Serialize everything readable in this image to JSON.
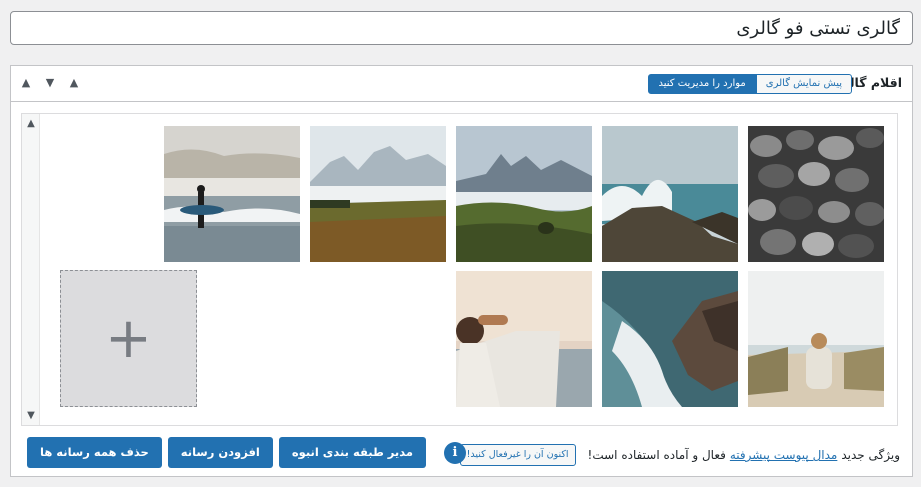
{
  "post": {
    "title": "گالری تستی فو گالری"
  },
  "metabox": {
    "title": "اقلام گالری",
    "tabs": [
      {
        "label": "پیش نمایش گالری",
        "active": false
      },
      {
        "label": "موارد را مدیریت کنید",
        "active": true
      }
    ],
    "controls": {
      "up": "▲",
      "down": "▼",
      "toggle": "▲"
    }
  },
  "gallery": {
    "items": [
      {
        "name": "black-pebbles"
      },
      {
        "name": "sea-waves-rocks"
      },
      {
        "name": "mountain-fog-meadow"
      },
      {
        "name": "misty-mountains-field"
      },
      {
        "name": "surfer-beach"
      },
      {
        "name": "person-sitting-dunes"
      },
      {
        "name": "crashing-waves-cliff"
      },
      {
        "name": "man-at-sunset-sea"
      }
    ],
    "add_symbol": "+",
    "scroll": {
      "up": "▲",
      "down": "▼"
    }
  },
  "footer": {
    "notice": {
      "prefix": "ویژگی جدید",
      "link": "مدال پیوست پیشرفته",
      "suffix": "فعال و آماده استفاده است!",
      "button": "اکنون آن را غیرفعال کنید!"
    },
    "buttons": {
      "bulk_taxonomy": "مدیر طبقه بندی انبوه",
      "add_media": "افزودن رسانه",
      "remove_all": "حذف همه رسانه ها"
    },
    "info_symbol": "i"
  },
  "colors": {
    "accent": "#2271b1",
    "border": "#c3c4c7",
    "background": "#f0f0f1"
  }
}
